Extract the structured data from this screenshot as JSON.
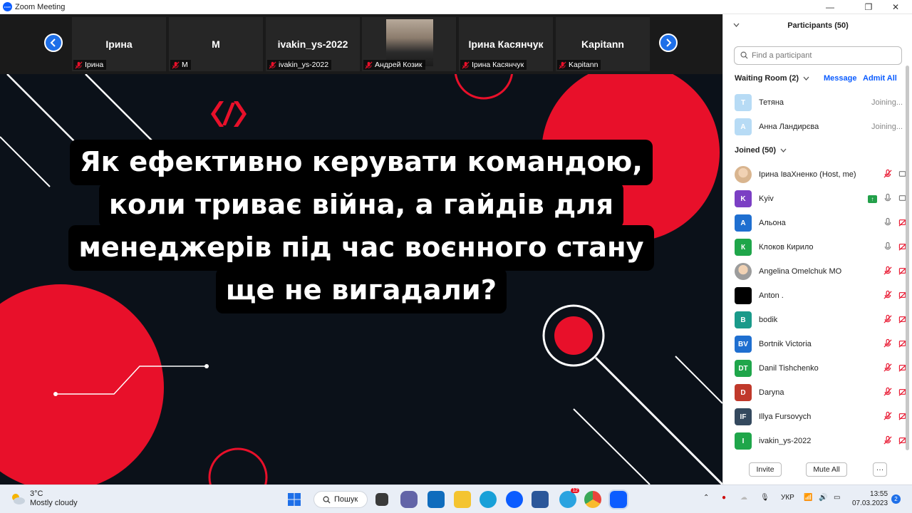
{
  "window": {
    "title": "Zoom Meeting",
    "minimize": "—",
    "maximize": "❐",
    "close": "✕"
  },
  "video_strip": {
    "tiles": [
      {
        "name": "Ірина",
        "label": "Ірина"
      },
      {
        "name": "М",
        "label": "М"
      },
      {
        "name": "ivakin_ys-2022",
        "label": "ivakin_ys-2022"
      },
      {
        "name": "",
        "label": "Андрей Козик"
      },
      {
        "name": "Ірина Касянчук",
        "label": "Ірина Касянчук"
      },
      {
        "name": "Kapitann",
        "label": "Kapitann"
      }
    ]
  },
  "slide": {
    "lines": [
      "Як ефективно керувати командою,",
      "коли триває війна, а гайдів для",
      "менеджерів під час воєнного стану",
      "ще не вигадали?"
    ],
    "colors": {
      "accent": "#e8102a",
      "background": "#0b1119"
    }
  },
  "participants": {
    "header": "Participants (50)",
    "search_placeholder": "Find a participant",
    "waiting_room": {
      "label": "Waiting Room (2)",
      "message": "Message",
      "admit_all": "Admit All",
      "people": [
        {
          "initial": "Т",
          "name": "Тетяна",
          "status": "Joining..."
        },
        {
          "initial": "А",
          "name": "Анна Ландирєва",
          "status": "Joining..."
        }
      ]
    },
    "joined": {
      "label": "Joined (50)",
      "people": [
        {
          "initial": "",
          "name": "Ірина ІваХненко (Host, me)",
          "color": "#d9b58f",
          "photo": true,
          "mic": "muted",
          "video": "camera"
        },
        {
          "initial": "K",
          "name": "Kyiv",
          "color": "#7b3fc4",
          "mic": "on",
          "video": "camera",
          "share": true
        },
        {
          "initial": "А",
          "name": "Альона",
          "color": "#1f6fd0",
          "mic": "on",
          "video": "off"
        },
        {
          "initial": "К",
          "name": "Клоков Кирило",
          "color": "#1fa64a",
          "mic": "on",
          "video": "off"
        },
        {
          "initial": "",
          "name": "Angelina Omelchuk MO",
          "color": "#9c9c9c",
          "photo": true,
          "mic": "muted",
          "video": "off"
        },
        {
          "initial": "",
          "name": "Anton .",
          "color": "#000000",
          "mic": "muted",
          "video": "off"
        },
        {
          "initial": "B",
          "name": "bodik",
          "color": "#1a9a8a",
          "mic": "muted",
          "video": "off"
        },
        {
          "initial": "BV",
          "name": "Bortnik Victoria",
          "color": "#1f6fd0",
          "mic": "muted",
          "video": "off"
        },
        {
          "initial": "DT",
          "name": "Danil Tishchenko",
          "color": "#1fa64a",
          "mic": "muted",
          "video": "off"
        },
        {
          "initial": "D",
          "name": "Daryna",
          "color": "#c0392b",
          "mic": "muted",
          "video": "off"
        },
        {
          "initial": "IF",
          "name": "Illya Fursovych",
          "color": "#34495e",
          "mic": "muted",
          "video": "off"
        },
        {
          "initial": "I",
          "name": "ivakin_ys-2022",
          "color": "#1fa64a",
          "mic": "muted",
          "video": "off"
        }
      ]
    },
    "footer": {
      "invite": "Invite",
      "mute_all": "Mute All",
      "more": "···"
    }
  },
  "taskbar": {
    "weather_temp": "3°C",
    "weather_desc": "Mostly cloudy",
    "search_label": "Пошук",
    "telegram_badge": "12",
    "language": "УКР",
    "time": "13:55",
    "date": "07.03.2023",
    "notifications": "2"
  }
}
